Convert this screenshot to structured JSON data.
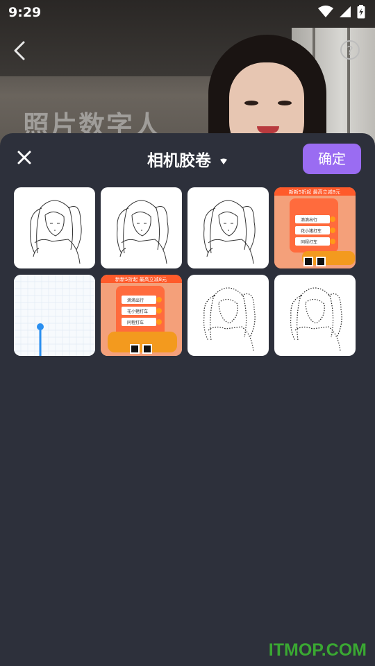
{
  "status_bar": {
    "time": "9:29"
  },
  "background": {
    "title_overlay": "照片数字人"
  },
  "sheet": {
    "album_title": "相机胶卷",
    "confirm_label": "确定"
  },
  "thumbnails": [
    {
      "kind": "sketch"
    },
    {
      "kind": "sketch"
    },
    {
      "kind": "sketch"
    },
    {
      "kind": "ad"
    },
    {
      "kind": "grid-chart"
    },
    {
      "kind": "ad"
    },
    {
      "kind": "dotted-sketch"
    },
    {
      "kind": "dotted-sketch"
    }
  ],
  "ad": {
    "banner": "新新5折起  最高立减8元",
    "items": [
      "滴滴出行",
      "花小猪打车",
      "同程打车"
    ]
  },
  "watermark": "ITMOP.COM",
  "colors": {
    "accent": "#9a6cf2",
    "sheet_bg": "#2d303b",
    "watermark": "#3aa832"
  }
}
